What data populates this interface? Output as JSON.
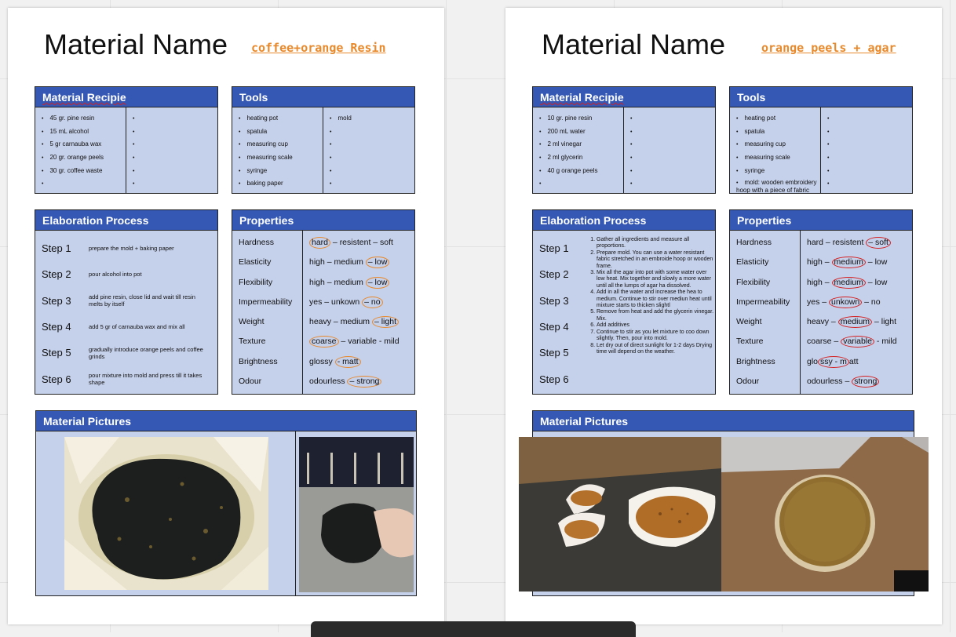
{
  "colors": {
    "header_blue": "#3558b4",
    "panel": "#c5d0ea",
    "link_orange": "#e8892b",
    "circle_red": "#d42020"
  },
  "pages": [
    {
      "title": "Material Name",
      "material": "coffee+orange Resin",
      "recipe": {
        "header": "Material Recipie",
        "col1": [
          "45 gr. pine resin",
          "15 mL alcohol",
          "5 gr carnauba wax",
          "20 gr. orange peels",
          "30 gr. coffee waste",
          ""
        ],
        "col2": [
          "",
          "",
          "",
          "",
          "",
          ""
        ]
      },
      "tools": {
        "header": "Tools",
        "col1": [
          "heating pot",
          "spatula",
          "measuring cup",
          "measuring scale",
          "syringe",
          "baking paper"
        ],
        "col2": [
          "mold",
          "",
          "",
          "",
          "",
          ""
        ]
      },
      "process": {
        "header": "Elaboration Process",
        "steps": [
          {
            "label": "Step 1",
            "text": "prepare the mold + baking paper"
          },
          {
            "label": "Step 2",
            "text": "pour alcohol into pot"
          },
          {
            "label": "Step 3",
            "text": "add pine resin, close lid and wait till resin melts by itself"
          },
          {
            "label": "Step 4",
            "text": "add 5 gr of carnauba wax and mix all"
          },
          {
            "label": "Step 5",
            "text": "gradually introduce orange peels and coffee grinds"
          },
          {
            "label": "Step 6",
            "text": "pour mixture into mold and press till it takes shape"
          }
        ]
      },
      "properties": {
        "header": "Properties",
        "rows": [
          {
            "name": "Hardness",
            "pre": "",
            "sel": "hard",
            "post": " – resistent – soft"
          },
          {
            "name": "Elasticity",
            "pre": "high – medium ",
            "sel": "– low",
            "post": ""
          },
          {
            "name": "Flexibility",
            "pre": "high – medium ",
            "sel": "– low",
            "post": ""
          },
          {
            "name": "Impermeability",
            "pre": "yes – unkown ",
            "sel": "– no",
            "post": ""
          },
          {
            "name": "Weight",
            "pre": "heavy – medium ",
            "sel": "– light",
            "post": ""
          },
          {
            "name": "Texture",
            "pre": "",
            "sel": "coarse",
            "post": " – variable - mild"
          },
          {
            "name": "Brightness",
            "pre": "glossy ",
            "sel": "- matt",
            "post": ""
          },
          {
            "name": "Odour",
            "pre": "odourless ",
            "sel": "– strong",
            "post": ""
          }
        ]
      },
      "pictures": {
        "header": "Material Pictures"
      }
    },
    {
      "title": "Material Name",
      "material": "orange peels + agar",
      "recipe": {
        "header": "Material Recipie",
        "col1": [
          "10 gr. pine resin",
          "200 mL water",
          "2 ml vinegar",
          "2 ml glycerin",
          "40 g orange peels",
          ""
        ],
        "col2": [
          "",
          "",
          "",
          "",
          "",
          ""
        ]
      },
      "tools": {
        "header": "Tools",
        "col1": [
          "heating pot",
          "spatula",
          "measuring cup",
          "measuring scale",
          "syringe",
          "mold: wooden embroidery hoop with a piece of fabric"
        ],
        "col2": [
          "",
          "",
          "",
          "",
          "",
          ""
        ]
      },
      "process": {
        "header": "Elaboration Process",
        "steps": [
          "Step 1",
          "Step 2",
          "Step 3",
          "Step 4",
          "Step 5",
          "Step 6"
        ],
        "instructions": [
          "Gather all ingredients and measure all proportions.",
          "Prepare mold. You can use a water resistant fabric stretched in an embroide hoop or wooden frame.",
          "Mix all the agar into pot with some water over low heat. Mix together and slowly a more water until all the lumps of agar ha dissolved.",
          "Add in all the water and increase the hea to medium. Continue to stir over mediun heat until mixture starts to thicken slightl",
          "Remove from heat and add the glycerin vinegar. Mix.",
          "Add additives",
          "Continue to stir as you let mixture to coo down slightly. Then, pour into mold.",
          "Let dry out of direct sunlight for 1-2 days Drying time will depend on the weather."
        ]
      },
      "properties": {
        "header": "Properties",
        "rows": [
          {
            "name": "Hardness",
            "pre": "hard – resistent ",
            "sel": "– soft",
            "post": ""
          },
          {
            "name": "Elasticity",
            "pre": "high – ",
            "sel": "medium",
            "post": " – low"
          },
          {
            "name": "Flexibility",
            "pre": "high – ",
            "sel": "medium",
            "post": " – low"
          },
          {
            "name": "Impermeability",
            "pre": "yes – ",
            "sel": "unkown",
            "post": " – no"
          },
          {
            "name": "Weight",
            "pre": "heavy – ",
            "sel": "medium",
            "post": " – light"
          },
          {
            "name": "Texture",
            "pre": "coarse – ",
            "sel": "variable",
            "post": " - mild"
          },
          {
            "name": "Brightness",
            "pre": "glo",
            "sel": "ssy - m",
            "post": "att"
          },
          {
            "name": "Odour",
            "pre": "odourless – ",
            "sel": "strong",
            "post": ""
          }
        ]
      },
      "pictures": {
        "header": "Material Pictures"
      }
    }
  ]
}
